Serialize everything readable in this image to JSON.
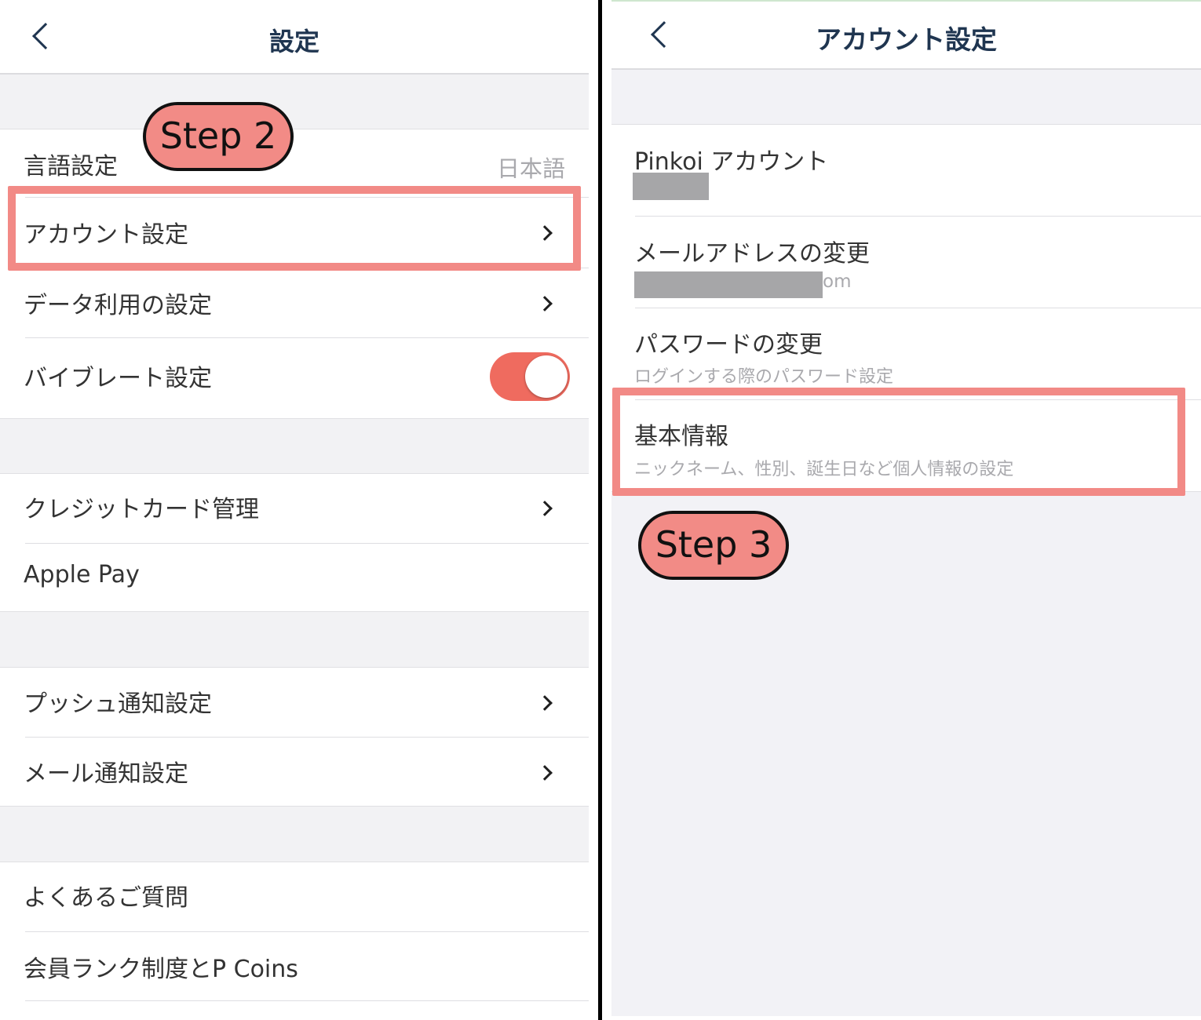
{
  "left": {
    "title": "設定",
    "language": {
      "label": "言語設定",
      "value": "日本語"
    },
    "account_settings": "アカウント設定",
    "data_usage": "データ利用の設定",
    "vibrate": {
      "label": "バイブレート設定",
      "enabled": true
    },
    "credit_card": "クレジットカード管理",
    "apple_pay": "Apple Pay",
    "push_notifications": "プッシュ通知設定",
    "mail_notifications": "メール通知設定",
    "faq": "よくあるご質問",
    "membership": "会員ランク制度とP Coins",
    "step_badge": "Step 2"
  },
  "right": {
    "title": "アカウント設定",
    "pinkoi_account": "Pinkoi アカウント",
    "email_change": {
      "label": "メールアドレスの変更",
      "value_suffix": "om"
    },
    "password_change": {
      "label": "パスワードの変更",
      "sub": "ログインする際のパスワード設定"
    },
    "basic_info": {
      "label": "基本情報",
      "sub": "ニックネーム、性別、誕生日など個人情報の設定"
    },
    "step_badge": "Step 3"
  },
  "colors": {
    "accent": "#f28a86",
    "toggle_on": "#ef6b5f",
    "nav_title": "#1f3550",
    "background": "#f2f2f4"
  }
}
